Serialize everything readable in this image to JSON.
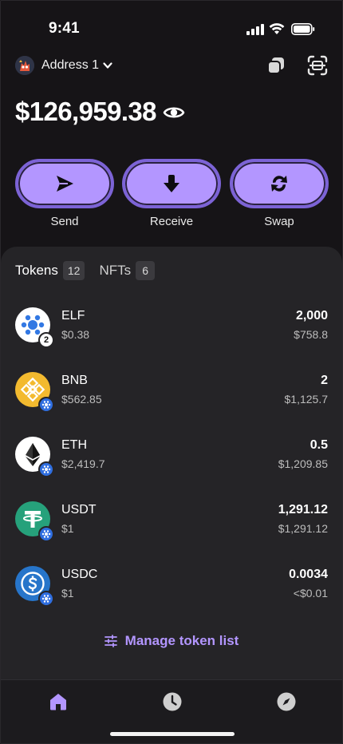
{
  "status_bar": {
    "time": "9:41"
  },
  "header": {
    "address_label": "Address 1"
  },
  "balance": {
    "total": "$126,959.38"
  },
  "actions": [
    {
      "label": "Send",
      "icon": "send-icon"
    },
    {
      "label": "Receive",
      "icon": "receive-icon"
    },
    {
      "label": "Swap",
      "icon": "swap-icon"
    }
  ],
  "tabs": [
    {
      "label": "Tokens",
      "count": "12",
      "active": true
    },
    {
      "label": "NFTs",
      "count": "6",
      "active": false
    }
  ],
  "tokens": [
    {
      "symbol": "ELF",
      "price": "$0.38",
      "balance": "2,000",
      "value": "$758.8",
      "badge": "2",
      "color": "#ffffff"
    },
    {
      "symbol": "BNB",
      "price": "$562.85",
      "balance": "2",
      "value": "$1,125.7",
      "badge": "",
      "color": "#f3ba2f"
    },
    {
      "symbol": "ETH",
      "price": "$2,419.7",
      "balance": "0.5",
      "value": "$1,209.85",
      "badge": "",
      "color": "#ffffff"
    },
    {
      "symbol": "USDT",
      "price": "$1",
      "balance": "1,291.12",
      "value": "$1,291.12",
      "badge": "",
      "color": "#26a17b"
    },
    {
      "symbol": "USDC",
      "price": "$1",
      "balance": "0.0034",
      "value": "<$0.01",
      "badge": "",
      "color": "#2775ca"
    }
  ],
  "manage": {
    "label": "Manage token list"
  },
  "colors": {
    "accent": "#b396ff",
    "accent_border": "#7c63d6",
    "background": "#161417",
    "sheet": "#252427"
  }
}
